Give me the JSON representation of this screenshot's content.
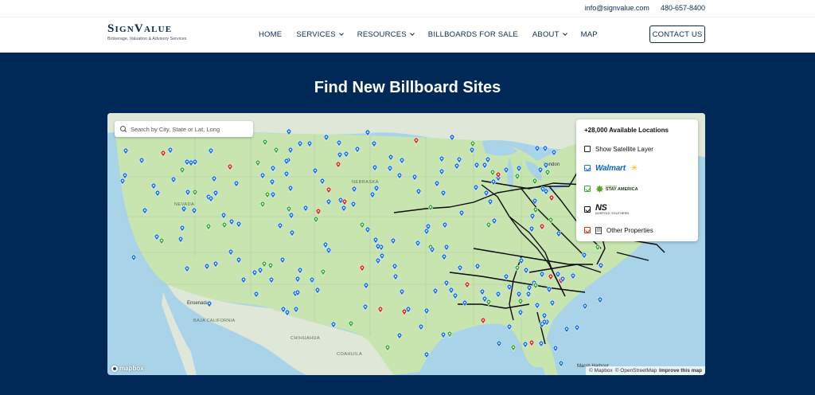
{
  "topbar": {
    "email": "info@signvalue.com",
    "phone": "480-657-8400"
  },
  "logo": {
    "wordmark": "SignValue",
    "tagline": "Brokerage, Valuation & Advisory Services"
  },
  "nav": {
    "items": [
      {
        "label": "HOME",
        "has_dropdown": false
      },
      {
        "label": "SERVICES",
        "has_dropdown": true
      },
      {
        "label": "RESOURCES",
        "has_dropdown": true
      },
      {
        "label": "BILLBOARDS FOR SALE",
        "has_dropdown": false
      },
      {
        "label": "ABOUT",
        "has_dropdown": true
      },
      {
        "label": "MAP",
        "has_dropdown": false
      }
    ],
    "cta": "CONTACT US"
  },
  "hero": {
    "title": "Find New Billboard Sites"
  },
  "map": {
    "search_placeholder": "Search by City, State or Lat, Long",
    "legend": {
      "title": "+28,000 Available Locations",
      "satellite_label": "Show Satellite Layer",
      "satellite_checked": false,
      "layers": [
        {
          "name": "Walmart",
          "checked": true,
          "color": "#1a73e8"
        },
        {
          "name": "Extended Stay America",
          "checked": true,
          "color": "#3daa3d"
        },
        {
          "name": "Norfolk Southern",
          "checked": true,
          "color": "#111111"
        },
        {
          "name": "Other Properties",
          "checked": true,
          "color": "#d93025"
        }
      ],
      "walmart_text": "Walmart",
      "esa_line1": "extended",
      "esa_line2": "STAY AMERICA",
      "ns_big": "NS",
      "ns_small": "NORFOLK SOUTHERN",
      "other_label": "Other Properties"
    },
    "labels": {
      "nebraska": "NEBRASKA",
      "nevada": "NEVADA",
      "baja": "BAJA CALIFORNIA",
      "chihuahua": "CHIHUAHUA",
      "coahuila": "COAHUILA",
      "ensenada": "Ensenada",
      "london": "London",
      "marsh_harbour": "Marsh Harbour"
    },
    "provider_logo": "mapbox",
    "attribution": {
      "mapbox": "© Mapbox",
      "osm": "© OpenStreetMap",
      "improve": "Improve this map"
    },
    "pin_colors": {
      "walmart": "#1a73e8",
      "esa": "#3daa3d",
      "other": "#d93025"
    }
  }
}
